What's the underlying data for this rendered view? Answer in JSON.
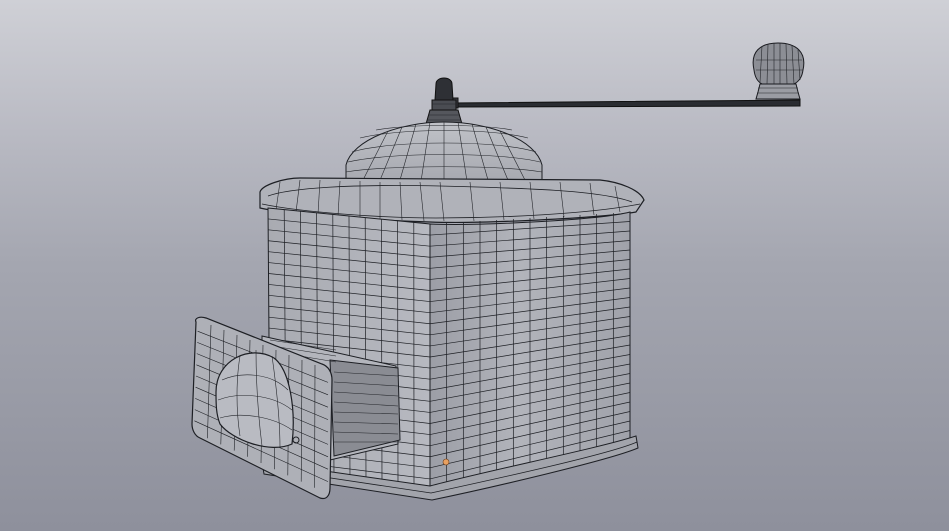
{
  "viewport": {
    "background_top": "#cfd0d6",
    "background_bottom": "#8e909c",
    "mesh_fill": "#a7a9b1",
    "mesh_fill_dark": "#8d8f97",
    "wire_color": "#1d1f24",
    "origin_marker_color": "#e8a060"
  },
  "scene": {
    "object": "coffee-grinder-mesh",
    "display_mode": "wireframe-over-solid"
  }
}
